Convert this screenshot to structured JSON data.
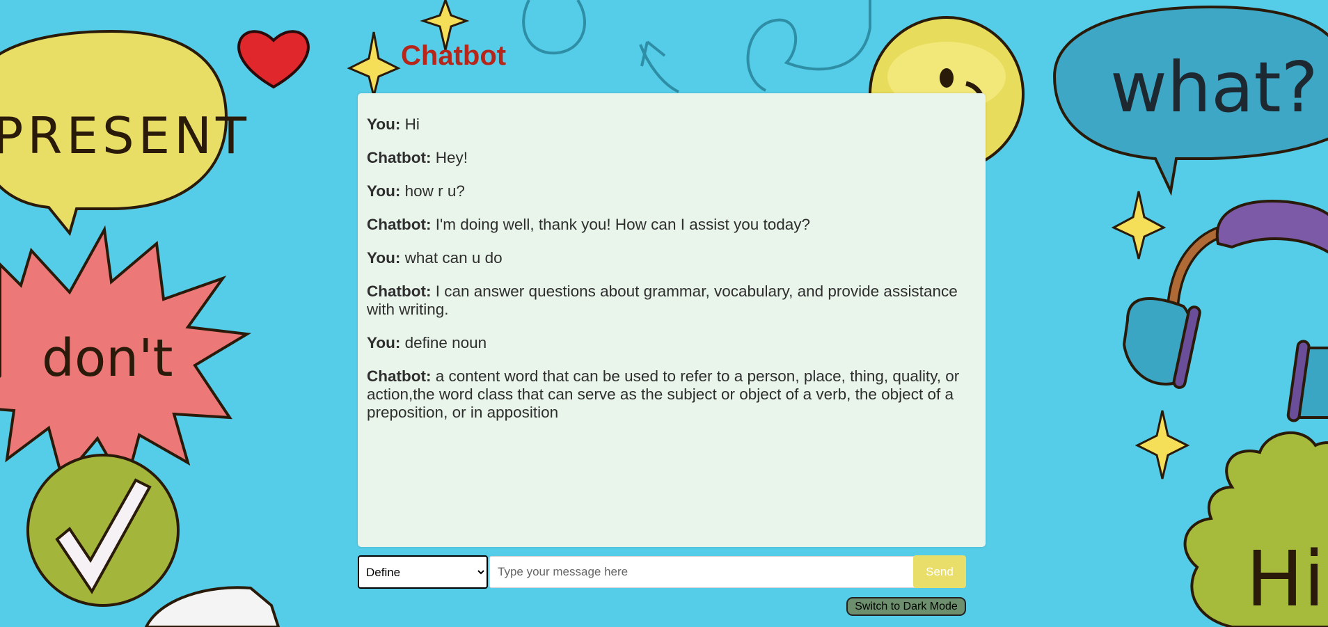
{
  "app": {
    "title": "Chatbot"
  },
  "stickers": {
    "present": "PRESENT",
    "dont": "don't",
    "what": "what?",
    "hi": "Hi!"
  },
  "messages": [
    {
      "speaker": "You:",
      "text": " Hi"
    },
    {
      "speaker": "Chatbot:",
      "text": " Hey!"
    },
    {
      "speaker": "You:",
      "text": " how r u?"
    },
    {
      "speaker": "Chatbot:",
      "text": " I'm doing well, thank you! How can I assist you today?"
    },
    {
      "speaker": "You:",
      "text": " what can u do"
    },
    {
      "speaker": "Chatbot:",
      "text": " I can answer questions about grammar, vocabulary, and provide assistance with writing."
    },
    {
      "speaker": "You:",
      "text": " define noun"
    },
    {
      "speaker": "Chatbot:",
      "text": " a content word that can be used to refer to a person, place, thing, quality, or action,the word class that can serve as the subject or object of a verb, the object of a preposition, or in apposition"
    }
  ],
  "controls": {
    "mode_selected": "Define",
    "input_value": "",
    "input_placeholder": "Type your message here",
    "send_label": "Send",
    "dark_mode_label": "Switch to Dark Mode"
  },
  "colors": {
    "background": "#55cde8",
    "title": "#b6261a",
    "chat_bg": "#e9f4ea",
    "send_button": "#e9de6a",
    "dark_mode_button": "#6d8f6d"
  },
  "icons": [
    "heart-icon",
    "sparkle-icon",
    "smiley-icon",
    "checkmark-icon",
    "headphones-icon"
  ]
}
